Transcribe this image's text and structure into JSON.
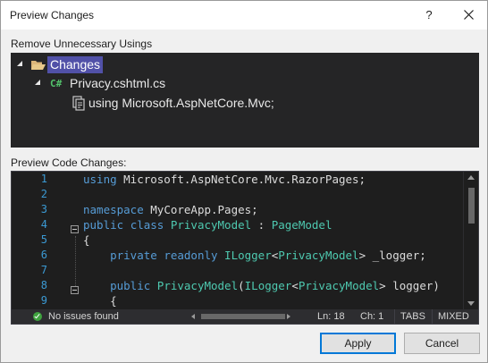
{
  "dialog": {
    "title": "Preview Changes",
    "help_label": "?"
  },
  "sections": {
    "changes_label": "Remove Unnecessary Usings",
    "preview_label": "Preview Code Changes:"
  },
  "tree": {
    "root_label": "Changes",
    "file_icon_text": "C#",
    "file_label": "Privacy.cshtml.cs",
    "change_label": "using Microsoft.AspNetCore.Mvc;"
  },
  "editor": {
    "lines": [
      {
        "num": "1",
        "tokens": [
          {
            "t": "using ",
            "c": "kw"
          },
          {
            "t": "Microsoft.AspNetCore.Mvc.RazorPages;",
            "c": "id"
          }
        ]
      },
      {
        "num": "2",
        "tokens": []
      },
      {
        "num": "3",
        "tokens": [
          {
            "t": "namespace ",
            "c": "kw"
          },
          {
            "t": "MyCoreApp.Pages;",
            "c": "id"
          }
        ]
      },
      {
        "num": "4",
        "tokens": [
          {
            "t": "public ",
            "c": "kw"
          },
          {
            "t": "class ",
            "c": "kw"
          },
          {
            "t": "PrivacyModel",
            "c": "ty"
          },
          {
            "t": " : ",
            "c": "id"
          },
          {
            "t": "PageModel",
            "c": "ty"
          }
        ]
      },
      {
        "num": "5",
        "tokens": [
          {
            "t": "{",
            "c": "id"
          }
        ]
      },
      {
        "num": "6",
        "tokens": [
          {
            "t": "    private ",
            "c": "kw"
          },
          {
            "t": "readonly ",
            "c": "kw"
          },
          {
            "t": "ILogger",
            "c": "ty"
          },
          {
            "t": "<",
            "c": "id"
          },
          {
            "t": "PrivacyModel",
            "c": "ty"
          },
          {
            "t": "> _logger;",
            "c": "id"
          }
        ]
      },
      {
        "num": "7",
        "tokens": []
      },
      {
        "num": "8",
        "tokens": [
          {
            "t": "    public ",
            "c": "kw"
          },
          {
            "t": "PrivacyModel",
            "c": "ty"
          },
          {
            "t": "(",
            "c": "id"
          },
          {
            "t": "ILogger",
            "c": "ty"
          },
          {
            "t": "<",
            "c": "id"
          },
          {
            "t": "PrivacyModel",
            "c": "ty"
          },
          {
            "t": "> logger)",
            "c": "id"
          }
        ]
      },
      {
        "num": "9",
        "tokens": [
          {
            "t": "    {",
            "c": "id"
          }
        ]
      }
    ]
  },
  "status": {
    "issues": "No issues found",
    "line": "Ln: 18",
    "col": "Ch: 1",
    "tabs": "TABS",
    "eol": "MIXED"
  },
  "buttons": {
    "apply": "Apply",
    "cancel": "Cancel"
  },
  "colors": {
    "keyword": "#569cd6",
    "type": "#4ec9b0",
    "selection": "#5151a8",
    "accent": "#0078d7"
  }
}
